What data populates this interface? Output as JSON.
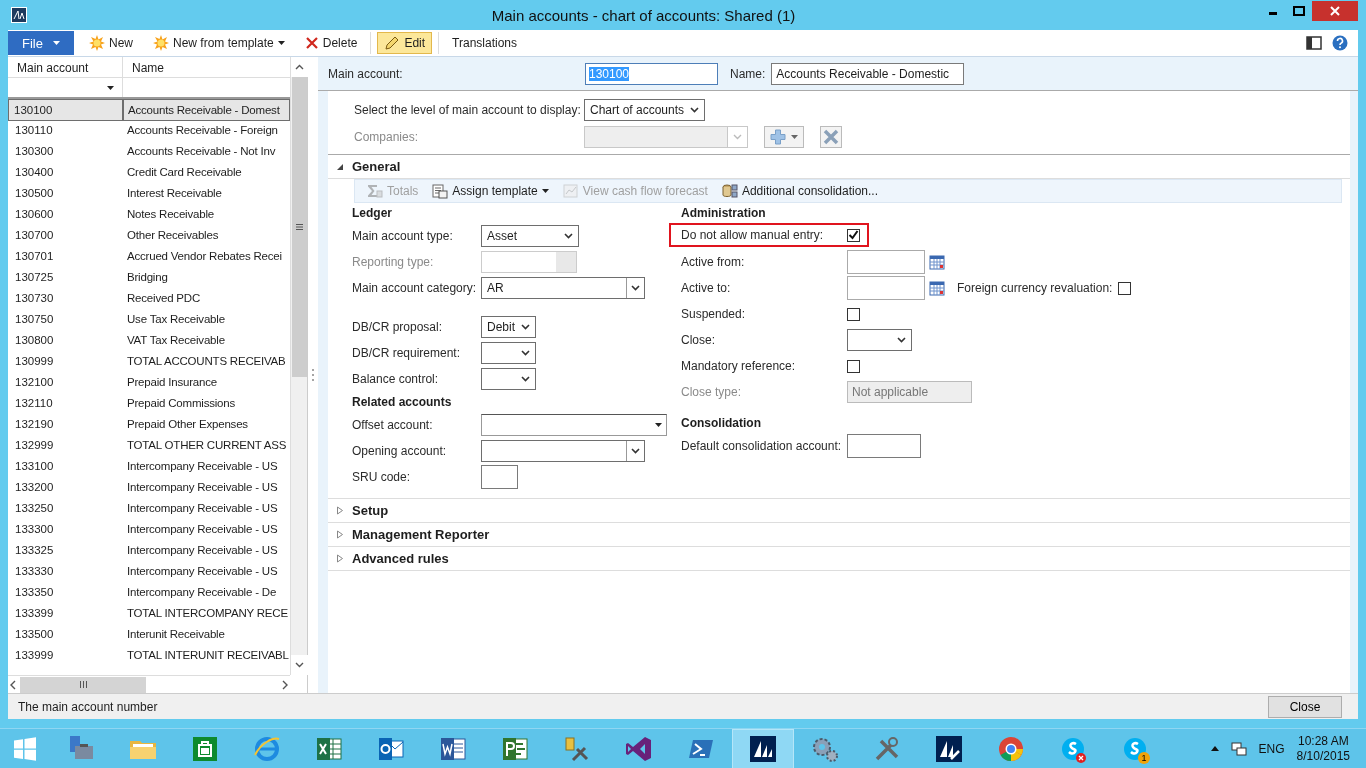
{
  "window": {
    "title": "Main accounts - chart of accounts: Shared (1)"
  },
  "ribbon": {
    "file": "File",
    "buttons": [
      {
        "label": "New",
        "kind": "new",
        "selected": false
      },
      {
        "label": "New from template",
        "kind": "new",
        "dropdown": true,
        "selected": false
      },
      {
        "label": "Delete",
        "kind": "delete",
        "selected": false
      },
      {
        "label": "Edit",
        "kind": "edit",
        "selected": true
      },
      {
        "label": "Translations",
        "kind": "plain",
        "selected": false
      }
    ]
  },
  "grid": {
    "columns": [
      "Main account",
      "Name"
    ],
    "rows": [
      {
        "account": "130100",
        "name": "Accounts Receivable - Domest",
        "selected": true
      },
      {
        "account": "130110",
        "name": "Accounts Receivable - Foreign",
        "selected": false
      },
      {
        "account": "130300",
        "name": "Accounts Receivable - Not Inv",
        "selected": false
      },
      {
        "account": "130400",
        "name": "Credit Card Receivable",
        "selected": false
      },
      {
        "account": "130500",
        "name": "Interest Receivable",
        "selected": false
      },
      {
        "account": "130600",
        "name": "Notes Receivable",
        "selected": false
      },
      {
        "account": "130700",
        "name": "Other Receivables",
        "selected": false
      },
      {
        "account": "130701",
        "name": "Accrued Vendor Rebates Recei",
        "selected": false
      },
      {
        "account": "130725",
        "name": "Bridging",
        "selected": false
      },
      {
        "account": "130730",
        "name": "Received PDC",
        "selected": false
      },
      {
        "account": "130750",
        "name": "Use Tax Receivable",
        "selected": false
      },
      {
        "account": "130800",
        "name": "VAT Tax Receivable",
        "selected": false
      },
      {
        "account": "130999",
        "name": "TOTAL ACCOUNTS RECEIVAB",
        "selected": false
      },
      {
        "account": "132100",
        "name": "Prepaid Insurance",
        "selected": false
      },
      {
        "account": "132110",
        "name": "Prepaid Commissions",
        "selected": false
      },
      {
        "account": "132190",
        "name": "Prepaid Other Expenses",
        "selected": false
      },
      {
        "account": "132999",
        "name": "TOTAL OTHER CURRENT ASS",
        "selected": false
      },
      {
        "account": "133100",
        "name": "Intercompany Receivable - US",
        "selected": false
      },
      {
        "account": "133200",
        "name": "Intercompany Receivable - US",
        "selected": false
      },
      {
        "account": "133250",
        "name": "Intercompany Receivable - US",
        "selected": false
      },
      {
        "account": "133300",
        "name": "Intercompany Receivable - US",
        "selected": false
      },
      {
        "account": "133325",
        "name": "Intercompany Receivable - US",
        "selected": false
      },
      {
        "account": "133330",
        "name": "Intercompany Receivable - US",
        "selected": false
      },
      {
        "account": "133350",
        "name": "Intercompany Receivable - De",
        "selected": false
      },
      {
        "account": "133399",
        "name": "TOTAL INTERCOMPANY RECE",
        "selected": false
      },
      {
        "account": "133500",
        "name": "Interunit Receivable",
        "selected": false
      },
      {
        "account": "133999",
        "name": "TOTAL INTERUNIT RECEIVABL",
        "selected": false
      }
    ]
  },
  "header": {
    "account_label": "Main account:",
    "account_value": "130100",
    "name_label": "Name:",
    "name_value": "Accounts Receivable - Domestic"
  },
  "level_select": {
    "label": "Select the level of main account to display:",
    "value": "Chart of accounts"
  },
  "companies": {
    "label": "Companies:",
    "disabled": true
  },
  "general": {
    "title": "General",
    "expanded": true,
    "toolbar": [
      {
        "label": "Totals",
        "kind": "sigma",
        "disabled": true
      },
      {
        "label": "Assign template",
        "kind": "template",
        "disabled": false,
        "dropdown": true
      },
      {
        "label": "View cash flow forecast",
        "kind": "forecast",
        "disabled": true
      },
      {
        "label": "Additional consolidation...",
        "kind": "database",
        "disabled": false
      }
    ],
    "ledger": [
      {
        "kind": "heading",
        "label": "Ledger"
      },
      {
        "kind": "select",
        "label": "Main account type:",
        "value": "Asset"
      },
      {
        "kind": "readonly",
        "label": "Reporting type:",
        "disabled": true
      },
      {
        "kind": "combo",
        "label": "Main account category:",
        "value": "AR"
      },
      {
        "kind": "select",
        "label": "DB/CR proposal:",
        "value": "Debit"
      },
      {
        "kind": "select",
        "label": "DB/CR requirement:"
      },
      {
        "kind": "select",
        "label": "Balance control:"
      },
      {
        "kind": "heading",
        "label": "Related accounts"
      },
      {
        "kind": "lookup",
        "label": "Offset account:"
      },
      {
        "kind": "combo",
        "label": "Opening account:"
      },
      {
        "kind": "text",
        "label": "SRU code:"
      }
    ],
    "admin": [
      {
        "kind": "heading",
        "label": "Administration"
      },
      {
        "kind": "checkbox",
        "label": "Do not allow manual entry:",
        "checked": true,
        "highlighted": true
      },
      {
        "kind": "date",
        "label": "Active from:"
      },
      {
        "kind": "date",
        "label": "Active to:",
        "extra": {
          "label": "Foreign currency revaluation:",
          "checked": false
        }
      },
      {
        "kind": "checkbox",
        "label": "Suspended:",
        "checked": false,
        "highlighted": false
      },
      {
        "kind": "select",
        "label": "Close:"
      },
      {
        "kind": "checkbox",
        "label": "Mandatory reference:",
        "checked": false,
        "highlighted": false
      },
      {
        "kind": "readonly",
        "label": "Close type:",
        "value": "Not applicable",
        "disabled": true
      },
      {
        "kind": "heading",
        "label": "Consolidation"
      },
      {
        "kind": "text",
        "label": "Default consolidation account:"
      }
    ]
  },
  "sections": [
    {
      "title": "Setup",
      "expanded": false
    },
    {
      "title": "Management Reporter",
      "expanded": false
    },
    {
      "title": "Advanced rules",
      "expanded": false
    }
  ],
  "status_bar": {
    "text": "The main account number",
    "button": "Close"
  },
  "taskbar": {
    "apps": [
      {
        "kind": "server",
        "selected": false
      },
      {
        "kind": "folder",
        "selected": false
      },
      {
        "kind": "store",
        "selected": false
      },
      {
        "kind": "browser",
        "selected": false
      },
      {
        "kind": "sheet",
        "selected": false
      },
      {
        "kind": "mail",
        "selected": false
      },
      {
        "kind": "doc",
        "selected": false
      },
      {
        "kind": "project",
        "selected": false
      },
      {
        "kind": "tools",
        "selected": false
      },
      {
        "kind": "infinity",
        "selected": false
      },
      {
        "kind": "terminal",
        "selected": false
      },
      {
        "kind": "sail",
        "selected": true
      },
      {
        "kind": "gear",
        "selected": false
      },
      {
        "kind": "wrench",
        "selected": false
      },
      {
        "kind": "sailtool",
        "selected": false
      },
      {
        "kind": "chrome",
        "selected": false
      },
      {
        "kind": "chat",
        "selected": false,
        "alert": true
      },
      {
        "kind": "chat",
        "selected": false,
        "badge": "1"
      }
    ],
    "language": "ENG",
    "time": "10:28 AM",
    "date": "8/10/2015"
  }
}
